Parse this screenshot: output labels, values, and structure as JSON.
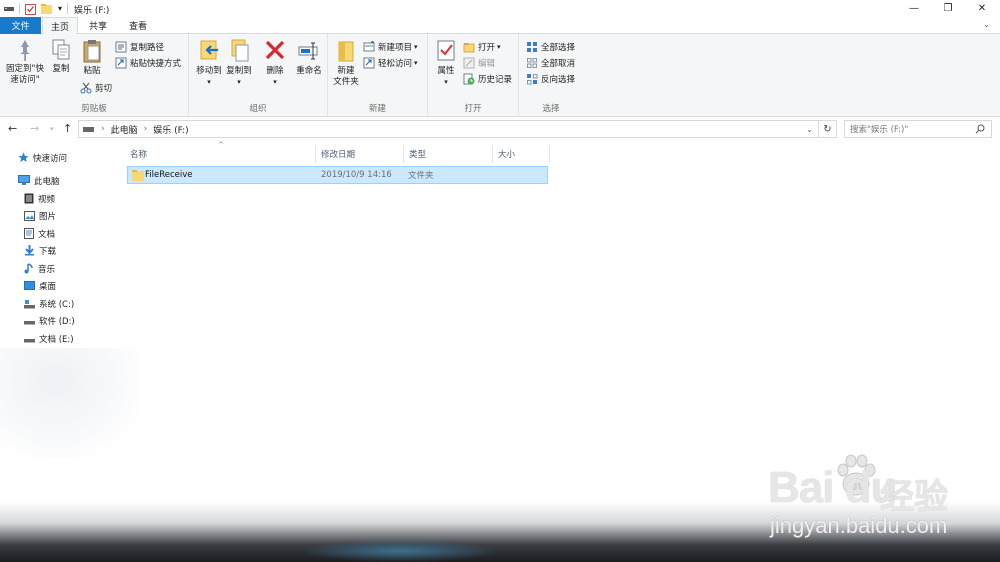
{
  "window": {
    "title": "娱乐 (F:)"
  },
  "window_controls": {
    "minimize": "—",
    "maximize": "❐",
    "close": "✕"
  },
  "tabs": [
    {
      "label": "文件"
    },
    {
      "label": "主页"
    },
    {
      "label": "共享"
    },
    {
      "label": "查看"
    }
  ],
  "ribbon": {
    "clipboard": {
      "pin_label": "固定到\"快\n速访问\"",
      "copy_label": "复制",
      "paste_label": "粘贴",
      "copy_path_label": "复制路径",
      "paste_shortcut_label": "粘贴快捷方式",
      "cut_label": "剪切",
      "group_label": "剪贴板"
    },
    "organize": {
      "move_to_label": "移动到",
      "copy_to_label": "复制到",
      "delete_label": "删除",
      "rename_label": "重命名",
      "group_label": "组织"
    },
    "new": {
      "new_folder_label": "新建\n文件夹",
      "new_item_label": "新建项目",
      "easy_access_label": "轻松访问",
      "group_label": "新建"
    },
    "open": {
      "properties_label": "属性",
      "open_label": "打开",
      "edit_label": "编辑",
      "history_label": "历史记录",
      "group_label": "打开"
    },
    "select": {
      "select_all_label": "全部选择",
      "select_none_label": "全部取消",
      "invert_label": "反向选择",
      "group_label": "选择"
    }
  },
  "address": {
    "crumbs": [
      "此电脑",
      "娱乐 (F:)"
    ],
    "search_placeholder": "搜索\"娱乐 (F:)\""
  },
  "nav": {
    "quick_access": "快速访问",
    "this_pc": "此电脑",
    "items": [
      {
        "label": "视频",
        "icon": "video-folder-icon"
      },
      {
        "label": "图片",
        "icon": "pictures-folder-icon"
      },
      {
        "label": "文档",
        "icon": "documents-folder-icon"
      },
      {
        "label": "下载",
        "icon": "downloads-folder-icon"
      },
      {
        "label": "音乐",
        "icon": "music-folder-icon"
      },
      {
        "label": "桌面",
        "icon": "desktop-folder-icon"
      },
      {
        "label": "系统 (C:)",
        "icon": "system-drive-icon"
      },
      {
        "label": "软件 (D:)",
        "icon": "drive-icon"
      },
      {
        "label": "文档 (E:)",
        "icon": "drive-icon"
      }
    ]
  },
  "columns": [
    "名称",
    "修改日期",
    "类型",
    "大小"
  ],
  "rows": [
    {
      "name": "FileReceive",
      "modified": "2019/10/9 14:16",
      "type": "文件夹",
      "size": ""
    }
  ],
  "watermark": {
    "logo": "Bai  du",
    "cn": "经验",
    "url": "jingyan.baidu.com"
  },
  "colors": {
    "accent": "#1979ca",
    "selection": "#cce8ff",
    "selection_border": "#99d1ff",
    "folder": "#f8d775"
  }
}
